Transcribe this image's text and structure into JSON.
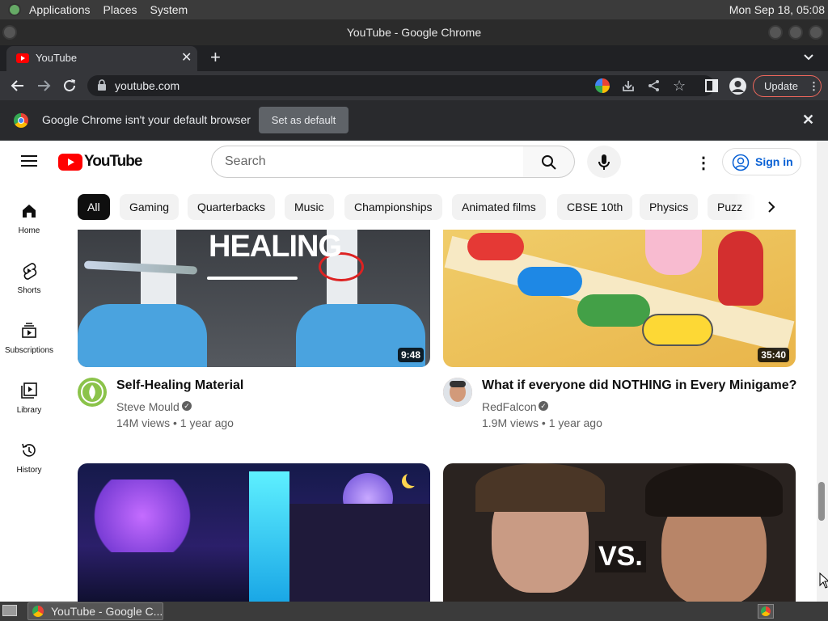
{
  "desktop": {
    "menus": [
      "Applications",
      "Places",
      "System"
    ],
    "clock": "Mon Sep 18, 05:08"
  },
  "window": {
    "title": "YouTube - Google Chrome"
  },
  "browser": {
    "tab_title": "YouTube",
    "url": "youtube.com",
    "update_label": "Update",
    "infobar_message": "Google Chrome isn't your default browser",
    "set_default_label": "Set as default"
  },
  "youtube": {
    "logo_text": "YouTube",
    "search_placeholder": "Search",
    "sign_in": "Sign in",
    "sidebar": [
      {
        "label": "Home",
        "icon": "home-icon"
      },
      {
        "label": "Shorts",
        "icon": "shorts-icon"
      },
      {
        "label": "Subscriptions",
        "icon": "subscriptions-icon"
      },
      {
        "label": "Library",
        "icon": "library-icon"
      },
      {
        "label": "History",
        "icon": "history-icon"
      }
    ],
    "chips": [
      "All",
      "Gaming",
      "Quarterbacks",
      "Music",
      "Championships",
      "Animated films",
      "CBSE 10th",
      "Physics",
      "Puzz"
    ],
    "videos": [
      {
        "title": "Self-Healing Material",
        "channel": "Steve Mould",
        "meta": "14M views • 1 year ago",
        "duration": "9:48",
        "overlay_text": "HEALING"
      },
      {
        "title": "What if everyone did NOTHING in Every Minigame?",
        "channel": "RedFalcon",
        "meta": "1.9M views • 1 year ago",
        "duration": "35:40"
      },
      {
        "title": "",
        "channel": "",
        "meta": "",
        "duration": ""
      },
      {
        "title": "",
        "channel": "",
        "meta": "",
        "duration": "",
        "overlay_text": "VS."
      }
    ]
  },
  "taskbar": {
    "item": "YouTube - Google C..."
  },
  "colors": {
    "yt_red": "#ff0000",
    "link_blue": "#065fd4",
    "chrome_dark": "#35363a"
  }
}
